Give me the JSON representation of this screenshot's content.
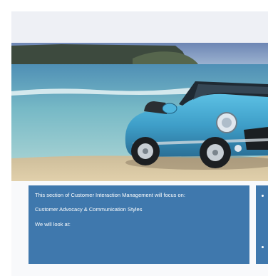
{
  "content_panel": {
    "intro": "This section of Customer Interaction Management will focus on:",
    "topic": "Customer Advocacy & Communication Styles",
    "lead_in": "We will look at:"
  },
  "hero_image": {
    "subject": "blue convertible car on a beach",
    "colors": {
      "sky": "#7fa0c8",
      "sea": "#6fb8c4",
      "sand": "#d8c7a4",
      "car": "#4aa6cf"
    }
  },
  "theme": {
    "panel_color": "#3f78ad",
    "background": "#f8f9fb"
  }
}
